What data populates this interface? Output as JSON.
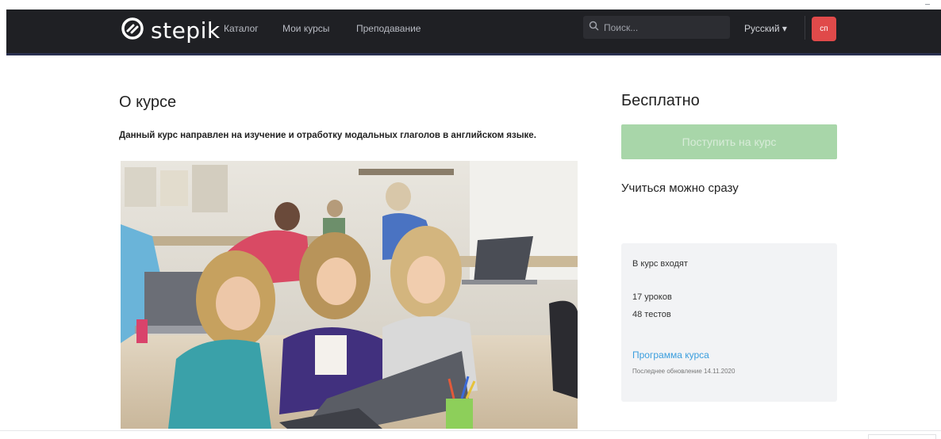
{
  "navbar": {
    "logo_text": "stepik",
    "links": [
      "Каталог",
      "Мои курсы",
      "Преподавание"
    ],
    "search_placeholder": "Поиск...",
    "language": "Русский ▾",
    "avatar_text": "сп"
  },
  "about": {
    "title": "О курсе",
    "description": "Данный курс направлен на изучение и отработку модальных глаголов в английском языке."
  },
  "sidebar": {
    "price": "Бесплатно",
    "enroll_label": "Поступить на курс",
    "start_text": "Учиться можно сразу",
    "info": {
      "heading": "В курс входят",
      "lessons": "17 уроков",
      "tests": "48 тестов",
      "program_link": "Программа курса",
      "updated": "Последнее обновление 14.11.2020"
    }
  },
  "colors": {
    "navbar_bg": "#1f2024",
    "enroll_button": "#a8d6a9",
    "link": "#3b9ede",
    "avatar": "#e04a4a"
  },
  "icons": [
    "stepik-logo-icon",
    "search-icon"
  ]
}
